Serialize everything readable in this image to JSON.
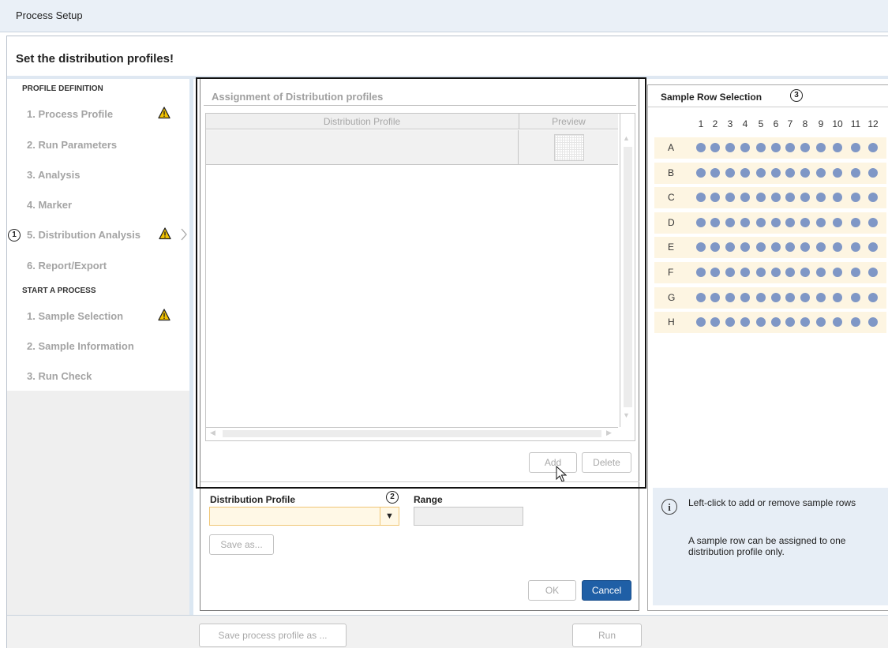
{
  "window": {
    "title": "Process Setup"
  },
  "main": {
    "title": "Set the distribution profiles!"
  },
  "sidebar": {
    "section1": "PROFILE DEFINITION",
    "section2": "START A PROCESS",
    "profile_items": [
      {
        "label": "1. Process Profile",
        "warning": true
      },
      {
        "label": "2. Run Parameters",
        "warning": false
      },
      {
        "label": "3. Analysis",
        "warning": false
      },
      {
        "label": "4. Marker",
        "warning": false
      },
      {
        "label": "5. Distribution Analysis",
        "warning": true,
        "selected": true
      },
      {
        "label": "6. Report/Export",
        "warning": false
      }
    ],
    "process_items": [
      {
        "label": "1. Sample Selection",
        "warning": true
      },
      {
        "label": "2. Sample Information",
        "warning": false
      },
      {
        "label": "3. Run Check",
        "warning": false
      }
    ],
    "callout": "1"
  },
  "assignment": {
    "title": "Assignment of Distribution profiles",
    "col_profile": "Distribution Profile",
    "col_preview": "Preview",
    "add_label": "Add",
    "delete_label": "Delete"
  },
  "form": {
    "profile_label": "Distribution Profile",
    "profile_value": "",
    "range_label": "Range",
    "range_value": "",
    "callout": "2",
    "save_as_label": "Save as...",
    "ok_label": "OK",
    "cancel_label": "Cancel"
  },
  "sample_rows": {
    "title": "Sample Row Selection",
    "callout": "3",
    "columns": [
      "1",
      "2",
      "3",
      "4",
      "5",
      "6",
      "7",
      "8",
      "9",
      "10",
      "11",
      "12"
    ],
    "rows": [
      "A",
      "B",
      "C",
      "D",
      "E",
      "F",
      "G",
      "H"
    ],
    "dot_color": "#7f97c6",
    "band_color": "#fdf5e2"
  },
  "info": {
    "line1": "Left-click to add or remove sample rows",
    "line2": "A sample row can be assigned to one distribution profile only."
  },
  "footer": {
    "save_profile_label": "Save process profile as ...",
    "run_label": "Run"
  },
  "colors": {
    "accent_button": "#1f5fa6",
    "warning": "#f2c200",
    "select_highlight": "#fff8e6"
  }
}
